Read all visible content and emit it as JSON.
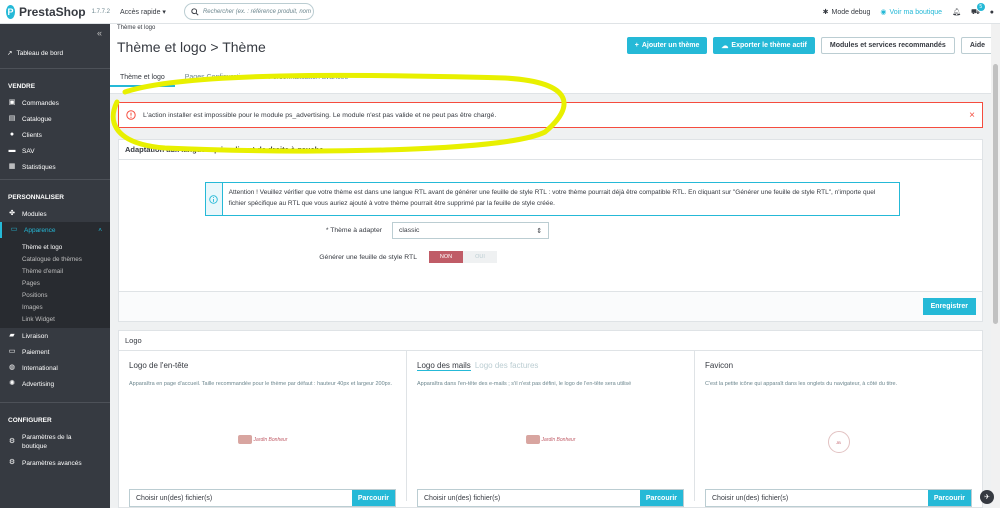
{
  "topbar": {
    "brand": "PrestaShop",
    "version": "1.7.7.2",
    "quick_access": "Accès rapide",
    "search_placeholder": "Rechercher (ex. : référence produit, nom",
    "debug_label": "Mode debug",
    "shop_label": "Voir ma boutique",
    "notif_badge": "5"
  },
  "sidebar": {
    "dashboard": "Tableau de bord",
    "sections": [
      {
        "title": "VENDRE",
        "items": [
          "Commandes",
          "Catalogue",
          "Clients",
          "SAV",
          "Statistiques"
        ]
      },
      {
        "title": "PERSONNALISER",
        "items": [
          "Modules",
          "Apparence"
        ]
      }
    ],
    "appearance_sub": [
      "Thème et logo",
      "Catalogue de thèmes",
      "Thème d'email",
      "Pages",
      "Positions",
      "Images",
      "Link Widget"
    ],
    "after_items": [
      "Livraison",
      "Paiement",
      "International",
      "Advertising"
    ],
    "configure_title": "CONFIGURER",
    "configure_items": [
      "Paramètres de la boutique",
      "Paramètres avancés"
    ]
  },
  "header": {
    "breadcrumb": "Thème et logo",
    "title": "Thème et logo > Thème",
    "btn_add": "Ajouter un thème",
    "btn_export": "Exporter le thème actif",
    "btn_modules": "Modules et services recommandés",
    "btn_help": "Aide",
    "tabs": [
      "Thème et logo",
      "Pages Configuration",
      "Personnalisation avancée"
    ]
  },
  "alert": {
    "text": "L'action installer est impossible pour le module ps_advertising. Le module n'est pas valide et ne peut pas être chargé."
  },
  "rtl_panel": {
    "title": "Adaptation aux langues qui se lisent de droite à gauche",
    "info": "Attention ! Veuillez vérifier que votre thème est dans une langue RTL avant de générer une feuille de style RTL : votre thème pourrait déjà être compatible RTL. En cliquant sur \"Générer une feuille de style RTL\", n'importe quel fichier spécifique au RTL que vous auriez ajouté à votre thème pourrait être supprimé par la feuille de style créée.",
    "theme_label": "* Thème à adapter",
    "theme_value": "classic",
    "gen_label": "Générer une feuille de style RTL",
    "switch_no": "NON",
    "switch_yes": "OUI",
    "save": "Enregistrer"
  },
  "logo_panel": {
    "title": "Logo",
    "col1_title": "Logo de l'en-tête",
    "col1_desc": "Apparaîtra en page d'accueil. Taille recommandée pour le thème par défaut : hauteur 40px et largeur 200px.",
    "col2_tab1": "Logo des mails",
    "col2_tab2": "Logo des factures",
    "col2_desc": "Apparaîtra dans l'en-tête des e-mails ; s'il n'est pas défini, le logo de l'en-tête sera utilisé",
    "col3_title": "Favicon",
    "col3_desc": "C'est la petite icône qui apparaît dans les onglets du navigateur, à côté du titre.",
    "file_placeholder": "Choisir un(des) fichier(s)",
    "browse": "Parcourir"
  },
  "colors": {
    "accent": "#25b9d7",
    "sidebar": "#363a41",
    "danger": "#f54c3e",
    "highlight": "#e8f000"
  }
}
